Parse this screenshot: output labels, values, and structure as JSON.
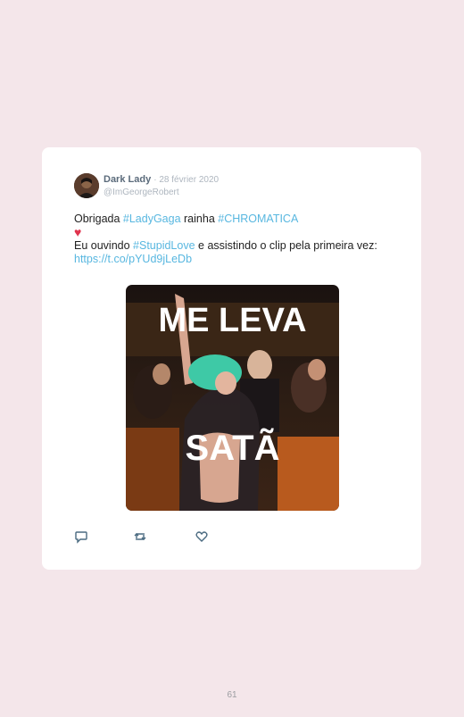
{
  "tweet": {
    "author_name": "Dark Lady",
    "date": "· 28 février 2020",
    "handle": "@ImGeorgeRobert",
    "line1_before": "Obrigada ",
    "hashtag1": "#LadyGaga",
    "line1_middle": " rainha ",
    "hashtag2": "#CHROMATICA",
    "heart": "♥",
    "line3_before": "Eu ouvindo ",
    "hashtag3": "#StupidLove",
    "line3_after": " e assistindo o clip pela primeira vez: ",
    "link": "https://t.co/pYUd9jLeDb",
    "image": {
      "caption_top": "ME LEVA",
      "caption_bottom": "SATÃ"
    }
  },
  "actions": {
    "reply_icon": "reply-icon",
    "retweet_icon": "retweet-icon",
    "like_icon": "heart-icon"
  },
  "page_number": "61"
}
